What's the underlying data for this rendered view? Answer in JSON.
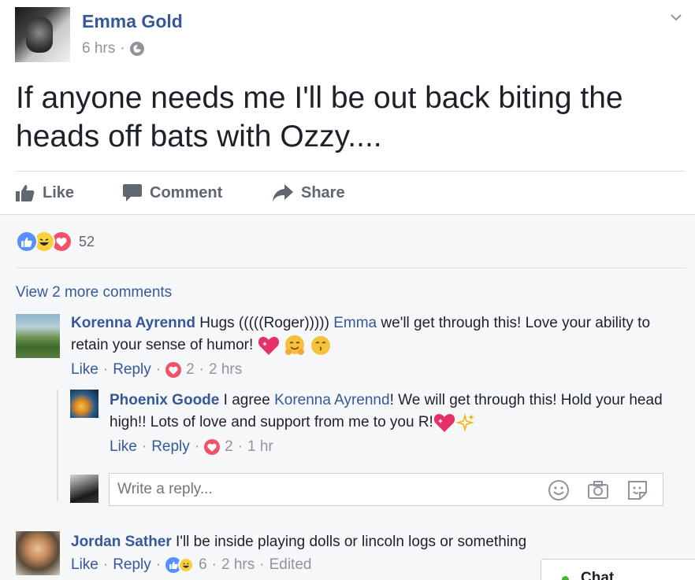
{
  "post": {
    "author": "Emma Gold",
    "time": "6 hrs",
    "separator": "·",
    "text": "If anyone needs me I'll be out back biting the heads off bats with Ozzy....",
    "actions": {
      "like": "Like",
      "comment": "Comment",
      "share": "Share"
    },
    "reactions": {
      "types": [
        "like",
        "haha",
        "love"
      ],
      "count": "52"
    }
  },
  "comments": {
    "view_more": "View 2 more comments",
    "items": [
      {
        "author": "Korenna Ayrennd",
        "text_before": "Hugs (((((Roger))))) ",
        "mention": "Emma",
        "text_after": " we'll get through this! Love your ability to retain your sense of humor! ",
        "emojis": [
          "sparkling-heart",
          "hugging-face",
          "kissing-face"
        ],
        "like_label": "Like",
        "reply_label": "Reply",
        "reaction_count": "2",
        "time": "2 hrs"
      },
      {
        "author": "Phoenix Goode",
        "text_before": " I agree ",
        "mention": "Korenna Ayrennd",
        "text_after": "! We will get through this! Hold your head high!! Lots of love and support from me to you R!",
        "emojis": [
          "sparkling-heart",
          "sparkles"
        ],
        "like_label": "Like",
        "reply_label": "Reply",
        "reaction_count": "2",
        "time": "1 hr"
      },
      {
        "author": "Jordan Sather",
        "text": " I'll be inside playing dolls or lincoln logs or something",
        "like_label": "Like",
        "reply_label": "Reply",
        "reaction_count": "6",
        "time": "2 hrs",
        "edited": "Edited"
      }
    ]
  },
  "reply_box": {
    "placeholder": "Write a reply...",
    "icons": [
      "emoji-icon",
      "camera-icon",
      "sticker-icon"
    ]
  },
  "chat": {
    "label": "Chat",
    "status_color": "#42b72a"
  },
  "colors": {
    "link": "#365899",
    "muted": "#90949c",
    "like_blue": "#5890ff",
    "love_red": "#f25268",
    "haha_yellow": "#f7d03c"
  }
}
